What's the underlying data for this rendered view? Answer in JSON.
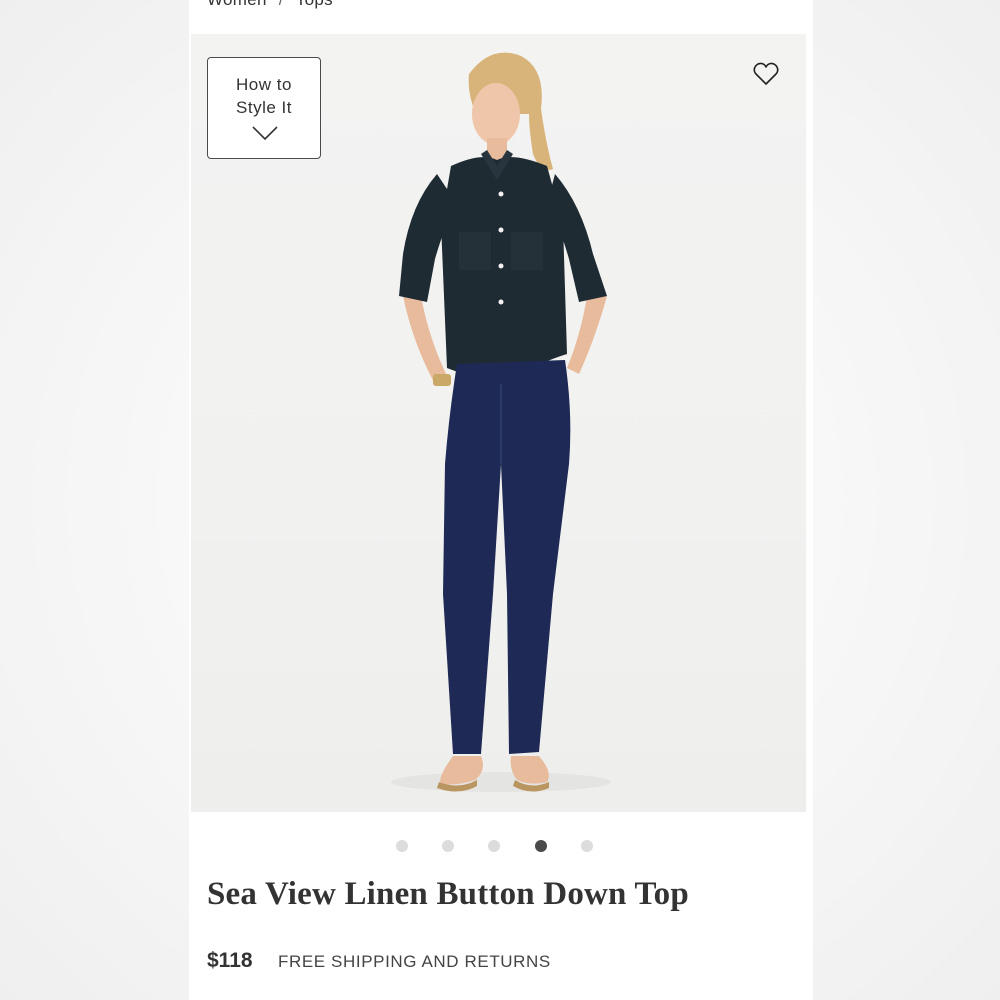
{
  "breadcrumb": {
    "items": [
      "Women",
      "Tops"
    ],
    "separator": "/"
  },
  "style_button": {
    "label_line1": "How to",
    "label_line2": "Style It",
    "icon": "chevron-down-icon"
  },
  "favorite": {
    "icon": "heart-icon"
  },
  "carousel": {
    "count": 5,
    "active_index": 3
  },
  "product": {
    "title": "Sea View Linen Button Down Top",
    "price": "$118",
    "shipping": "FREE SHIPPING AND RETURNS"
  },
  "colors": {
    "text": "#333333",
    "dot_inactive": "#dcdcdc",
    "dot_active": "#4a4a4a",
    "shirt": "#1f2b33",
    "jeans": "#1e2a55"
  }
}
